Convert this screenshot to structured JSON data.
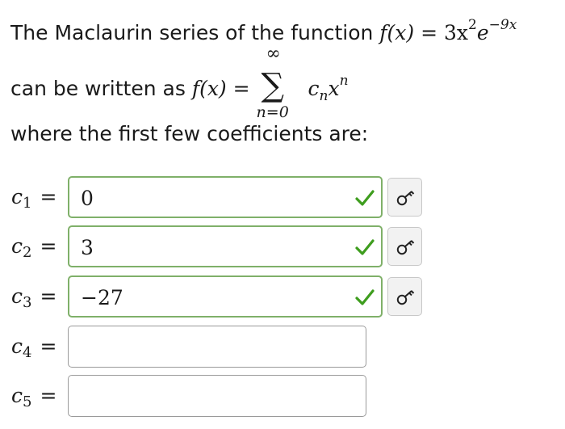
{
  "intro": {
    "line1_text": "The Maclaurin series of the function",
    "func_lhs": "f(x)",
    "equals": "=",
    "func_rhs_base": "3x",
    "func_rhs_sq": "2",
    "func_rhs_e": "e",
    "func_rhs_exp": "−9x",
    "line2_text": "can be written as",
    "sum_lhs": "f(x)",
    "sum_upper": "∞",
    "sum_lower": "n=0",
    "sum_term_c": "c",
    "sum_term_sub": "n",
    "sum_term_x": "x",
    "sum_term_exp": "n",
    "line3_text": "where the first few coefficients are:"
  },
  "coefficients": [
    {
      "label": "c",
      "sub": "1",
      "eq": "=",
      "value": "0",
      "status": "correct"
    },
    {
      "label": "c",
      "sub": "2",
      "eq": "=",
      "value": "3",
      "status": "correct"
    },
    {
      "label": "c",
      "sub": "3",
      "eq": "=",
      "value": "−27",
      "status": "correct"
    },
    {
      "label": "c",
      "sub": "4",
      "eq": "=",
      "value": "",
      "status": "empty"
    },
    {
      "label": "c",
      "sub": "5",
      "eq": "=",
      "value": "",
      "status": "empty"
    }
  ],
  "colors": {
    "correct_border": "#7fb069",
    "check": "#3e9d1e",
    "empty_border": "#9a9a9a"
  },
  "icons": {
    "status": "check-icon",
    "key": "key-icon"
  }
}
